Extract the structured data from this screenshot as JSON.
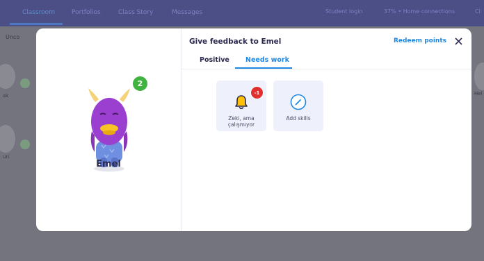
{
  "background_app": {
    "tabs": [
      "Classroom",
      "Portfolios",
      "Class Story",
      "Messages"
    ],
    "chips": [
      "Student login",
      "37% • Home connections",
      "Cl"
    ],
    "side_label": "Unco",
    "edge_labels": [
      "Hel",
      "ak",
      "uri"
    ]
  },
  "dialog": {
    "title": "Give feedback to Emel",
    "redeem_label": "Redeem points",
    "tabs": [
      {
        "label": "Positive",
        "active": false
      },
      {
        "label": "Needs work",
        "active": true
      }
    ]
  },
  "student": {
    "name": "Emel",
    "points": "2"
  },
  "skills": [
    {
      "label": "Zeki, ama çalışmıyor",
      "badge": "-1",
      "icon": "bell-icon"
    },
    {
      "label": "Add skills",
      "badge": "",
      "icon": "pencil-circle-icon"
    }
  ],
  "colors": {
    "accent": "#1e88e5",
    "points_badge": "#3fb33f",
    "negative_badge": "#e02f2f",
    "bell": "#ffc107"
  }
}
